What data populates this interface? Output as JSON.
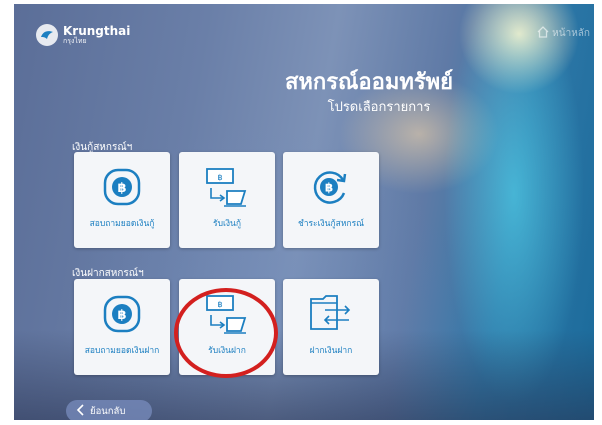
{
  "brand": {
    "name": "Krungthai",
    "subname": "กรุงไทย"
  },
  "header": {
    "home_label": "หน้าหลัก"
  },
  "page": {
    "title": "สหกรณ์ออมทรัพย์",
    "subtitle": "โปรดเลือกรายการ"
  },
  "sections": [
    {
      "label": "เงินกู้สหกรณ์ฯ",
      "items": [
        {
          "label": "สอบถามยอดเงินกู้",
          "icon": "baht-coin-icon"
        },
        {
          "label": "รับเงินกู้",
          "icon": "receive-cash-icon"
        },
        {
          "label": "ชำระเงินกู้สหกรณ์",
          "icon": "baht-refresh-icon"
        }
      ]
    },
    {
      "label": "เงินฝากสหกรณ์ฯ",
      "items": [
        {
          "label": "สอบถามยอดเงินฝาก",
          "icon": "baht-coin-icon"
        },
        {
          "label": "รับเงินฝาก",
          "icon": "receive-cash-icon"
        },
        {
          "label": "ฝากเงินฝาก",
          "icon": "transfer-document-icon"
        }
      ]
    }
  ],
  "footer": {
    "back_label": "ย้อนกลับ"
  },
  "colors": {
    "tile_icon": "#1c7fc1",
    "highlight": "#d3201f"
  }
}
